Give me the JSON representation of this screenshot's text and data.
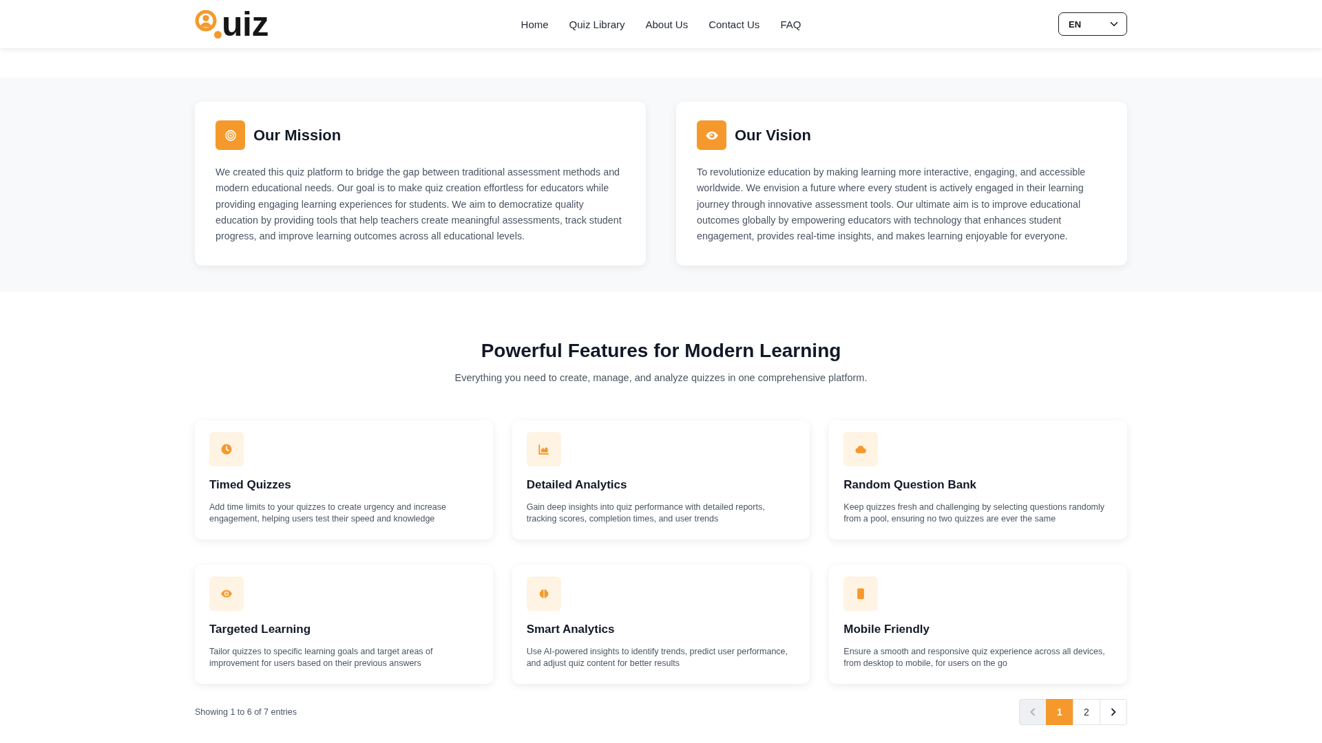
{
  "header": {
    "logo": {
      "text": "uiz"
    },
    "nav": [
      {
        "label": "Home"
      },
      {
        "label": "Quiz Library"
      },
      {
        "label": "About Us"
      },
      {
        "label": "Contact Us"
      },
      {
        "label": "FAQ"
      }
    ],
    "language_select": {
      "value": "EN"
    }
  },
  "about_cards": [
    {
      "title": "Our Mission",
      "text": "We created this quiz platform to bridge the gap between traditional assessment methods and modern educational needs. Our goal is to make quiz creation effortless for educators while providing engaging learning experiences for students. We aim to democratize quality education by providing tools that help teachers create meaningful assessments, track student progress, and improve learning outcomes across all educational levels."
    },
    {
      "title": "Our Vision",
      "text": "To revolutionize education by making learning more interactive, engaging, and accessible worldwide. We envision a future where every student is actively engaged in their learning journey through innovative assessment tools. Our ultimate aim is to improve educational outcomes globally by empowering educators with technology that enhances student engagement, provides real-time insights, and makes learning enjoyable for everyone."
    }
  ],
  "features": {
    "title": "Powerful Features for Modern Learning",
    "subtitle": "Everything you need to create, manage, and analyze quizzes in one comprehensive platform.",
    "items": [
      {
        "title": "Timed Quizzes",
        "description": "Add time limits to your quizzes to create urgency and increase engagement, helping users test their speed and knowledge"
      },
      {
        "title": "Detailed Analytics",
        "description": "Gain deep insights into quiz performance with detailed reports, tracking scores, completion times, and user trends"
      },
      {
        "title": "Random Question Bank",
        "description": "Keep quizzes fresh and challenging by selecting questions randomly from a pool, ensuring no two quizzes are ever the same"
      },
      {
        "title": "Targeted Learning",
        "description": "Tailor quizzes to specific learning goals and target areas of improvement for users based on their previous answers"
      },
      {
        "title": "Smart Analytics",
        "description": "Use AI-powered insights to identify trends, predict user performance, and adjust quiz content for better results"
      },
      {
        "title": "Mobile Friendly",
        "description": "Ensure a smooth and responsive quiz experience across all devices, from desktop to mobile, for users on the go"
      }
    ],
    "entries_info": "Showing 1 to 6 of 7 entries",
    "pagination": {
      "previous": {
        "disabled": true
      },
      "pages": [
        {
          "label": "1",
          "selected": true
        },
        {
          "label": "2",
          "selected": false
        }
      ],
      "next": {
        "disabled": false
      }
    }
  }
}
